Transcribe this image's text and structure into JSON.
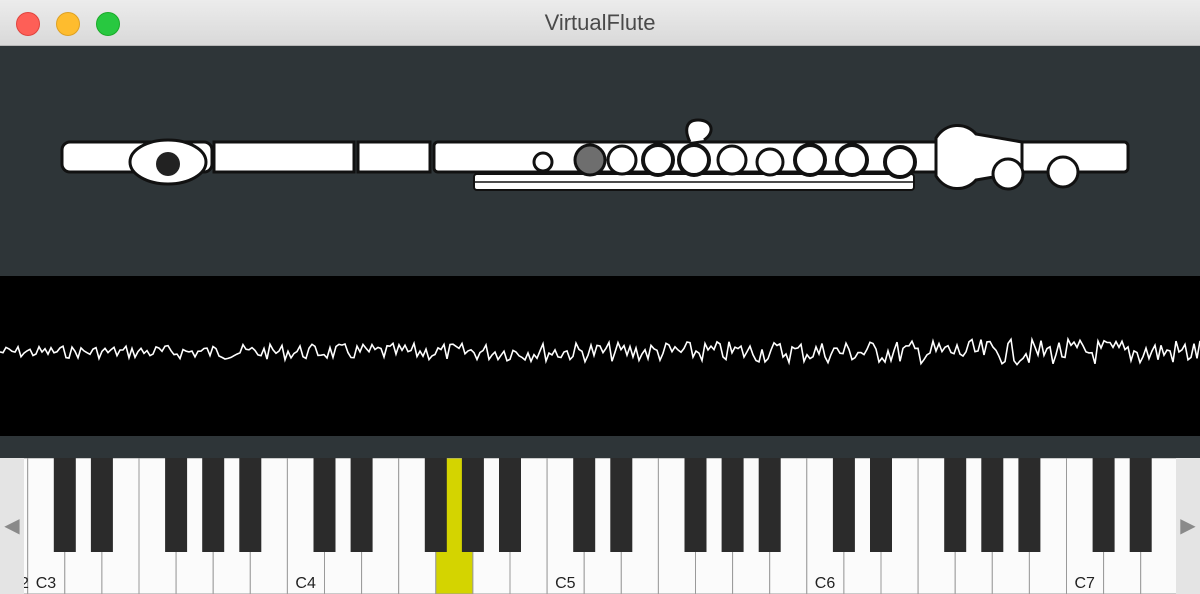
{
  "window": {
    "title": "VirtualFlute"
  },
  "keyboard": {
    "labels": [
      "2",
      "C3",
      "C4",
      "C5",
      "C6",
      "C7"
    ],
    "left_arrow": "◀",
    "right_arrow": "▶",
    "highlight_color": "#d4d400"
  },
  "colors": {
    "panel": "#2e3538",
    "scope_bg": "#000000",
    "wave": "#ffffff"
  }
}
